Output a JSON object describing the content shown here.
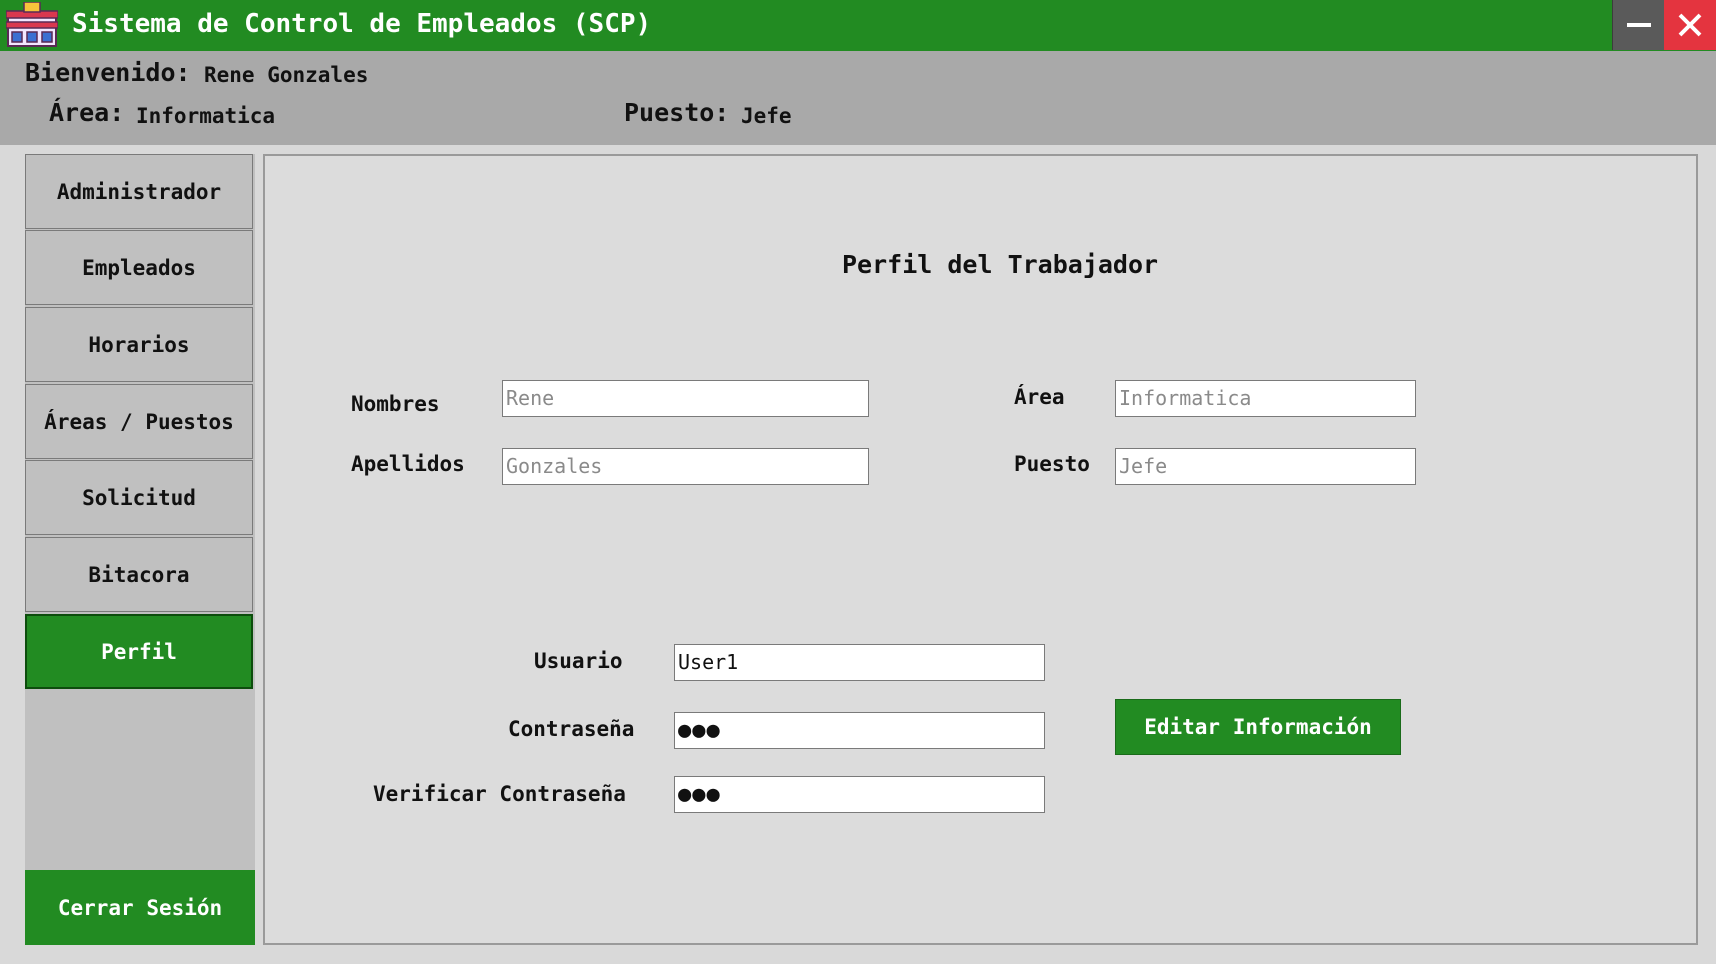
{
  "window": {
    "title": "Sistema de Control de Empleados (SCP)",
    "minimize_glyph": "—",
    "close_glyph": "✕",
    "colors": {
      "accent": "#228b22",
      "header": "#a9a9a9",
      "close": "#e4343f"
    }
  },
  "header": {
    "welcome_label": "Bienvenido:",
    "user_name": "Rene Gonzales",
    "area_label": "Área:",
    "area_value": "Informatica",
    "position_label": "Puesto:",
    "position_value": "Jefe"
  },
  "sidebar": {
    "items": [
      {
        "label": "Administrador",
        "active": false
      },
      {
        "label": "Empleados",
        "active": false
      },
      {
        "label": "Horarios",
        "active": false
      },
      {
        "label": "Áreas / Puestos",
        "active": false
      },
      {
        "label": "Solicitud",
        "active": false
      },
      {
        "label": "Bitacora",
        "active": false
      },
      {
        "label": "Perfil",
        "active": true
      }
    ],
    "logout_label": "Cerrar Sesión"
  },
  "profile": {
    "title": "Perfil del Trabajador",
    "first_name_label": "Nombres",
    "first_name_value": "Rene",
    "last_name_label": "Apellidos",
    "last_name_value": "Gonzales",
    "area_label": "Área",
    "area_value": "Informatica",
    "position_label": "Puesto",
    "position_value": "Jefe",
    "username_label": "Usuario",
    "username_value": "User1",
    "password_label": "Contraseña",
    "password_value": "●●●",
    "verify_password_label": "Verificar Contraseña",
    "verify_password_value": "●●●",
    "edit_button_label": "Editar Información"
  }
}
